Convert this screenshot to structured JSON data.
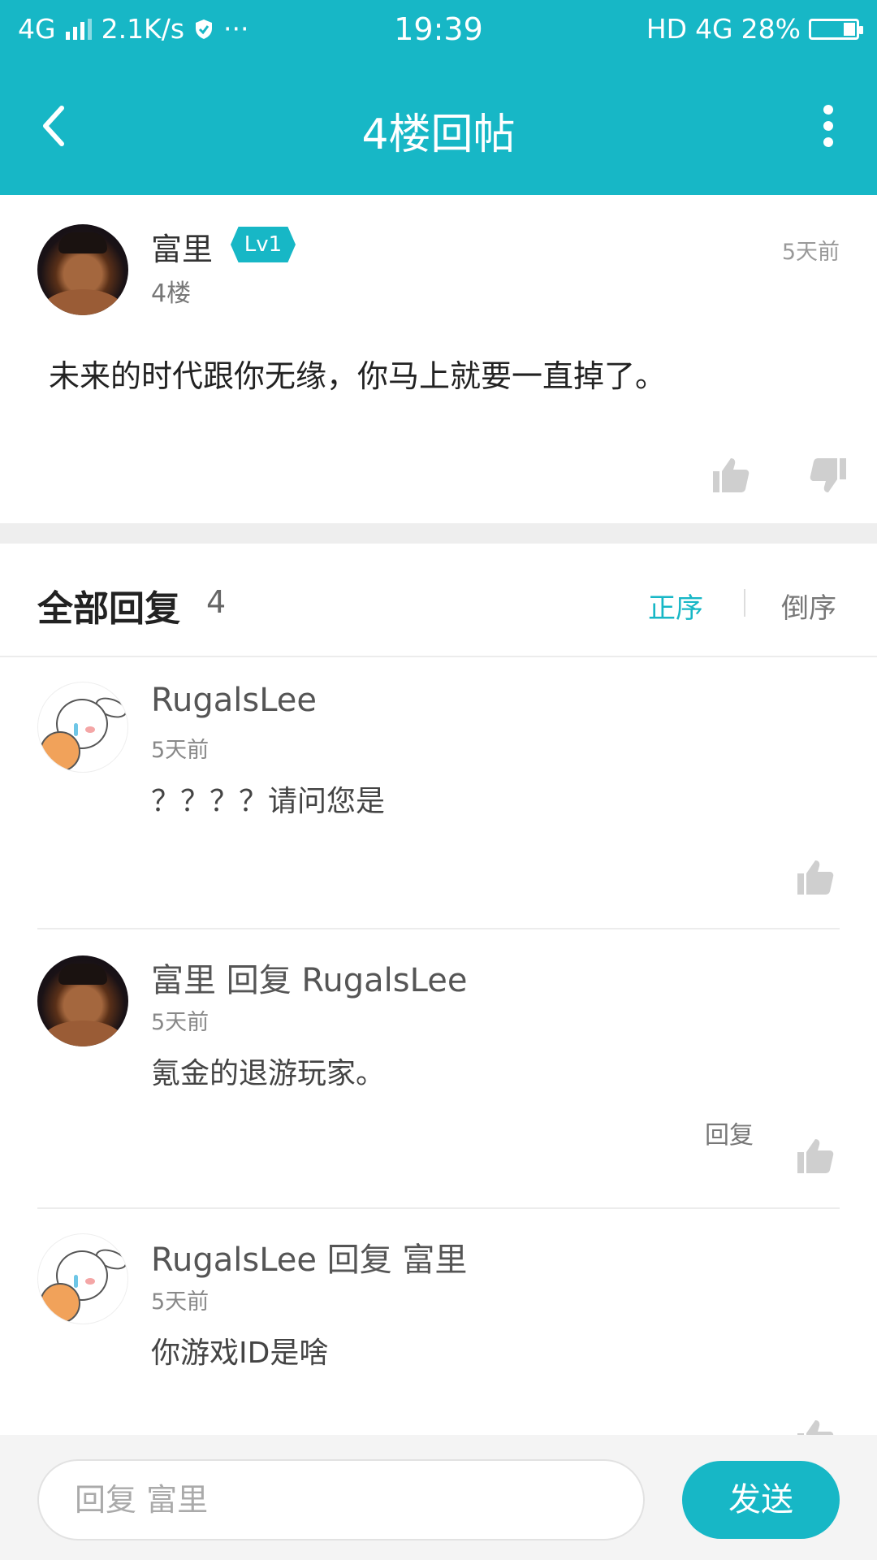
{
  "status_bar": {
    "network": "4G",
    "speed": "2.1K/s",
    "more": "···",
    "time": "19:39",
    "hd": "HD",
    "network2": "4G",
    "battery": "28%"
  },
  "header": {
    "title": "4楼回帖"
  },
  "post": {
    "author": "富里",
    "level": "Lv1",
    "floor": "4楼",
    "time": "5天前",
    "content": "未来的时代跟你无缘，你马上就要一直掉了。"
  },
  "replies_header": {
    "title": "全部回复",
    "count": "4",
    "sort_asc": "正序",
    "sort_desc": "倒序"
  },
  "replies": [
    {
      "name": "RugalsLee",
      "time": "5天前",
      "text": "？？？？请问您是",
      "avatar": "bunny"
    },
    {
      "name": "富里 回复 RugalsLee",
      "time": "5天前",
      "text": " 氪金的退游玩家。",
      "reply_label": "回复",
      "avatar": "fighter"
    },
    {
      "name": "RugalsLee 回复 富里",
      "time": "5天前",
      "text": "你游戏ID是啥",
      "avatar": "bunny"
    }
  ],
  "composer": {
    "placeholder": "回复 富里",
    "send_label": "发送"
  },
  "colors": {
    "accent": "#17b7c6",
    "background_band": "#eeeeee"
  }
}
